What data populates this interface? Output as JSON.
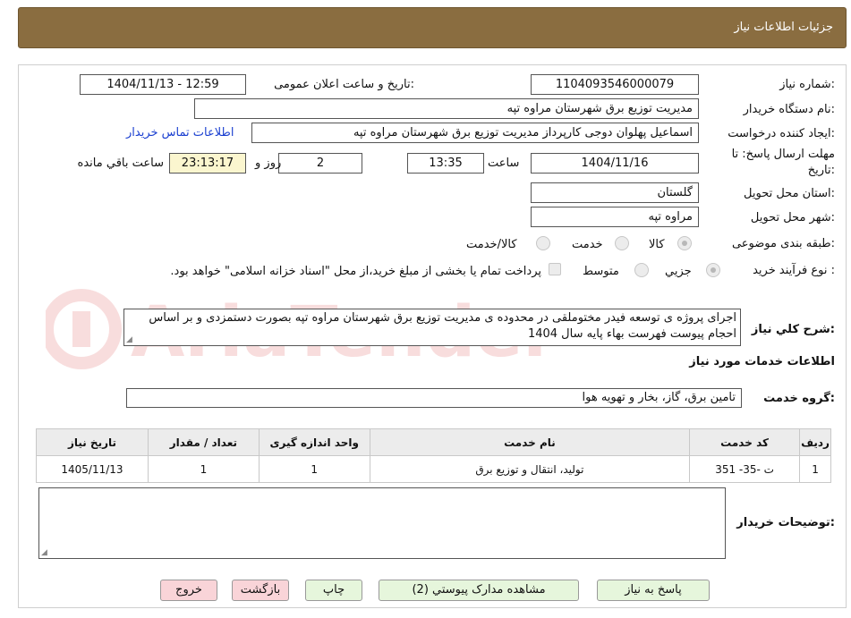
{
  "header": {
    "title": "جزئیات اطلاعات نیاز"
  },
  "form": {
    "need_number_label": "شماره نیاز:",
    "need_number": "1104093546000079",
    "announce_label": "تاریخ و ساعت اعلان عمومی:",
    "announce_value": "1404/11/13 - 12:59",
    "buyer_label": "نام دستگاه خریدار:",
    "buyer_value": "مدیریت توزیع برق شهرستان مراوه تپه",
    "creator_label": "ایجاد کننده درخواست:",
    "creator_value": "اسماعیل پهلوان دوجی کارپرداز مدیریت توزیع برق شهرستان مراوه تپه",
    "contact_link": "اطلاعات تماس خریدار",
    "deadline_label_line1": "مهلت ارسال پاسخ: تا",
    "deadline_label_line2": "تاریخ:",
    "deadline_date": "1404/11/16",
    "time_label": "ساعت",
    "deadline_time": "13:35",
    "days_value": "2",
    "days_label": "روز و",
    "remaining_time": "23:13:17",
    "remaining_label": "ساعت باقي مانده",
    "province_label": "استان محل تحویل:",
    "province_value": "گلستان",
    "city_label": "شهر محل تحویل:",
    "city_value": "مراوه تپه",
    "category_label": "طبقه بندی موضوعی:",
    "category_options": [
      "کالا",
      "خدمت",
      "کالا/خدمت"
    ],
    "process_label": "نوع فرآیند خرید :",
    "process_options": [
      "جزيي",
      "متوسط"
    ],
    "treasury_text": "پرداخت تمام یا بخشی از مبلغ خرید،از محل \"اسناد خزانه اسلامی\" خواهد بود.",
    "description_label": "شرح كلي نياز:",
    "description_value": "اجرای پروژه ی توسعه فیدر مختوملقی در محدوده ی مدیریت توزیع برق شهرستان مراوه تپه بصورت دستمزدی و بر اساس احجام پیوست فهرست بهاء پایه سال 1404"
  },
  "services": {
    "section_title": "اطلاعات خدمات مورد نیاز",
    "group_label": "گروه خدمت:",
    "group_value": "تامین برق، گاز، بخار و تهویه هوا",
    "columns": [
      "ردیف",
      "کد خدمت",
      "نام خدمت",
      "واحد اندازه گیری",
      "تعداد / مقدار",
      "تاریخ نیاز"
    ],
    "rows": [
      [
        "1",
        "ت -35- 351",
        "تولید، انتقال و توزیع برق",
        "1",
        "1",
        "1405/11/13"
      ]
    ]
  },
  "buyer_notes": {
    "label": "توضیحات خریدار:",
    "value": ""
  },
  "buttons": {
    "reply": "پاسخ به نیاز",
    "attachments": "مشاهده مدارک پیوستي (2)",
    "print": "چاپ",
    "back": "بازگشت",
    "exit": "خروج"
  },
  "colors": {
    "header_bg": "#8a6d40",
    "green_button": "#e6f6dc",
    "pink_button": "#f9d4d8",
    "remaining_bg": "#fbf6cf",
    "link": "#1a3fd0"
  }
}
